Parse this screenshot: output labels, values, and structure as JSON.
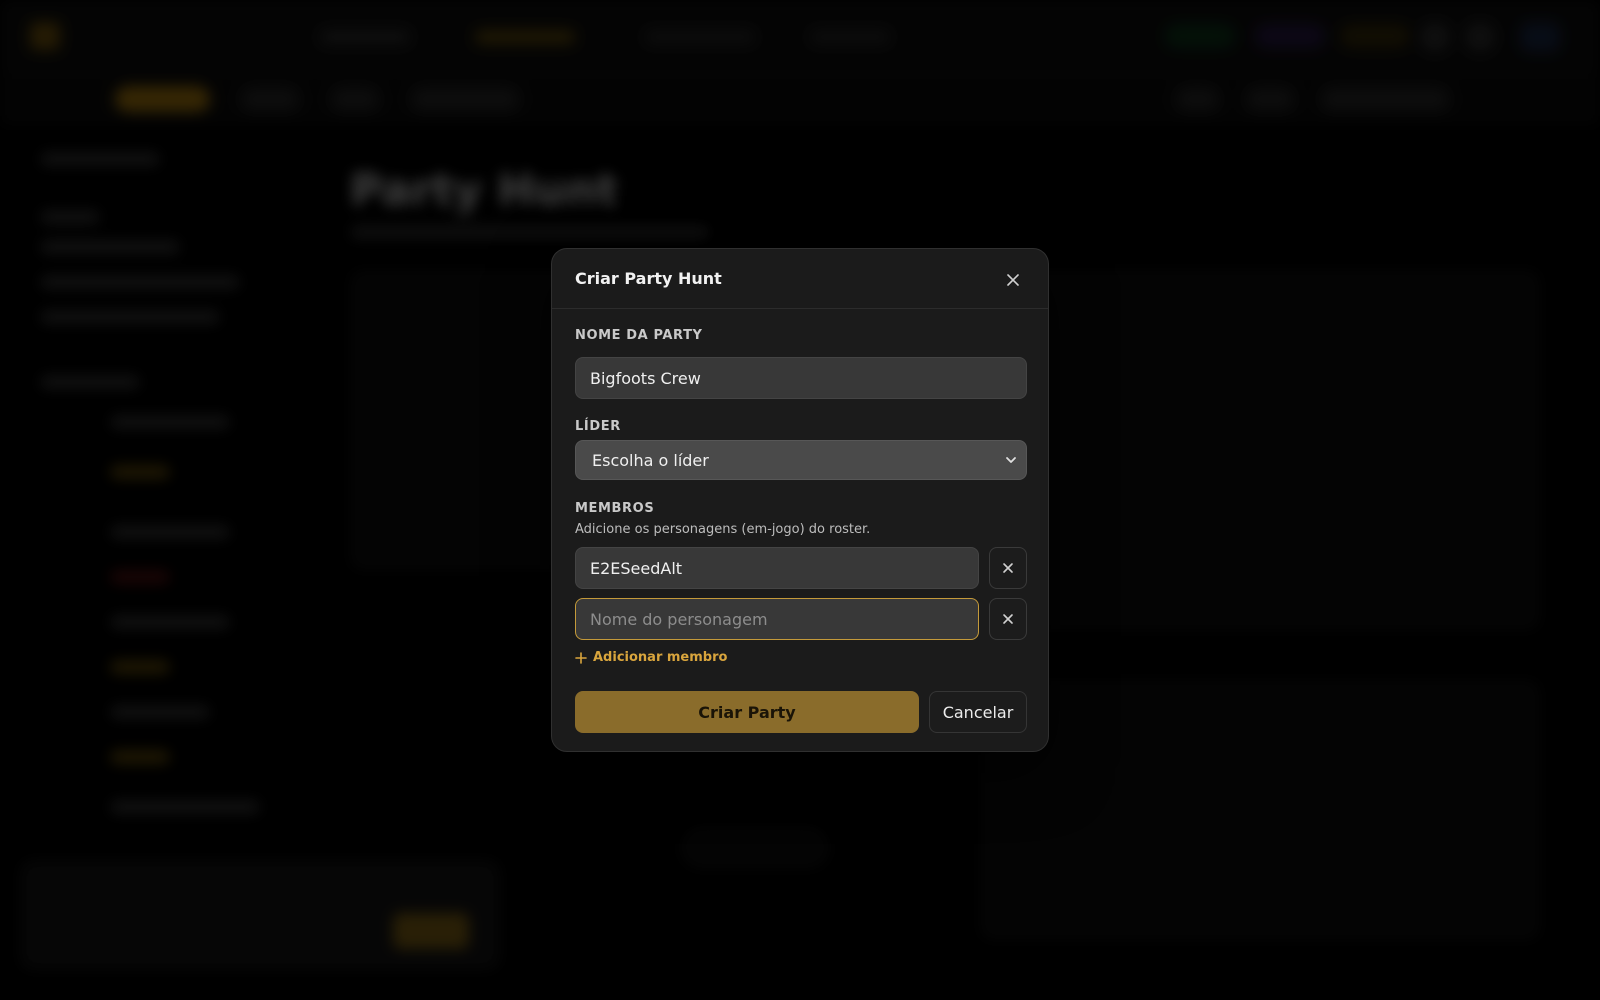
{
  "modal": {
    "title": "Criar Party Hunt",
    "close_icon": "close-icon",
    "party_name": {
      "label": "NOME DA PARTY",
      "value": "Bigfoots Crew"
    },
    "leader": {
      "label": "LÍDER",
      "selected": "Escolha o líder"
    },
    "members": {
      "label": "MEMBROS",
      "hint": "Adicione os personagens (em-jogo) do roster.",
      "items": [
        {
          "value": "E2ESeedAlt",
          "placeholder": ""
        },
        {
          "value": "",
          "placeholder": "Nome do personagem"
        }
      ],
      "add_label": "Adicionar membro"
    },
    "submit_label": "Criar Party",
    "cancel_label": "Cancelar"
  },
  "background": {
    "page_title": "Party Hunt"
  },
  "colors": {
    "accent": "#d9a53d",
    "primary_button": "#8a6c2b",
    "focus_border": "#c49a3a",
    "modal_bg": "#1b1b1b"
  }
}
